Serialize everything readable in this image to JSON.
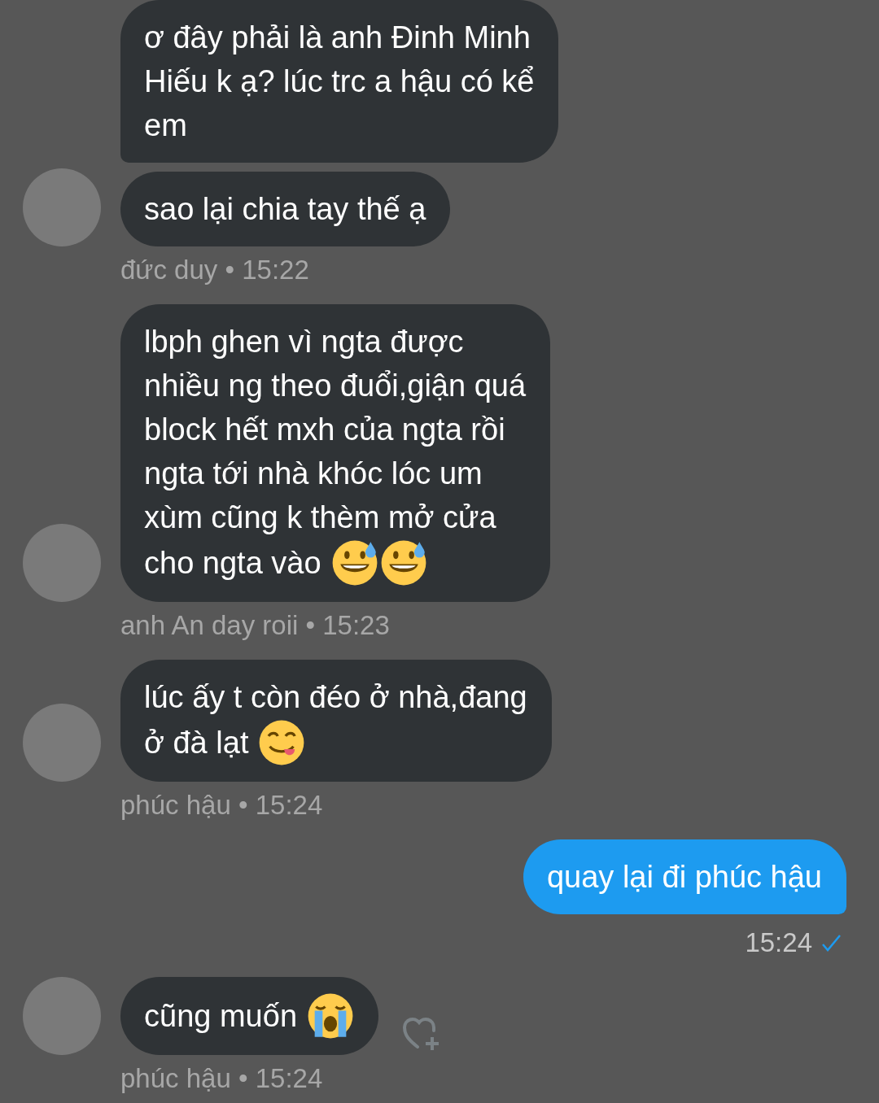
{
  "messages": [
    {
      "kind": "incoming",
      "bubbles": [
        {
          "lines": [
            "ơ đây phải là anh Đinh Minh",
            "Hiếu k ạ? lúc trc a hậu có kể",
            "em"
          ]
        },
        {
          "lines": [
            "sao lại chia tay thế ạ"
          ]
        }
      ],
      "meta": "đức duy • 15:22"
    },
    {
      "kind": "incoming",
      "bubbles": [
        {
          "lines": [
            "lbph ghen vì ngta được",
            "nhiều ng theo đuổi,giận quá",
            "block hết mxh của ngta rồi",
            "ngta tới nhà khóc lóc um",
            "xùm cũng k thèm mở cửa",
            "cho ngta vào"
          ],
          "emojis": [
            {
              "kind": "sweat-smile"
            },
            {
              "kind": "sweat-smile"
            }
          ]
        }
      ],
      "meta": "anh An day roii • 15:23"
    },
    {
      "kind": "incoming",
      "bubbles": [
        {
          "lines": [
            "lúc ấy t còn đéo ở nhà,đang",
            "ở đà lạt"
          ],
          "emojis": [
            {
              "kind": "yum"
            }
          ]
        }
      ],
      "meta": "phúc hậu • 15:24"
    },
    {
      "kind": "outgoing",
      "bubbles": [
        {
          "lines": [
            "quay lại đi phúc hậu"
          ]
        }
      ],
      "meta": "15:24",
      "seen": true
    },
    {
      "kind": "incoming",
      "bubbles": [
        {
          "lines": [
            "cũng muốn"
          ],
          "emojis": [
            {
              "kind": "sob"
            }
          ]
        }
      ],
      "meta": "phúc hậu • 15:24",
      "reaction_button": true
    }
  ]
}
